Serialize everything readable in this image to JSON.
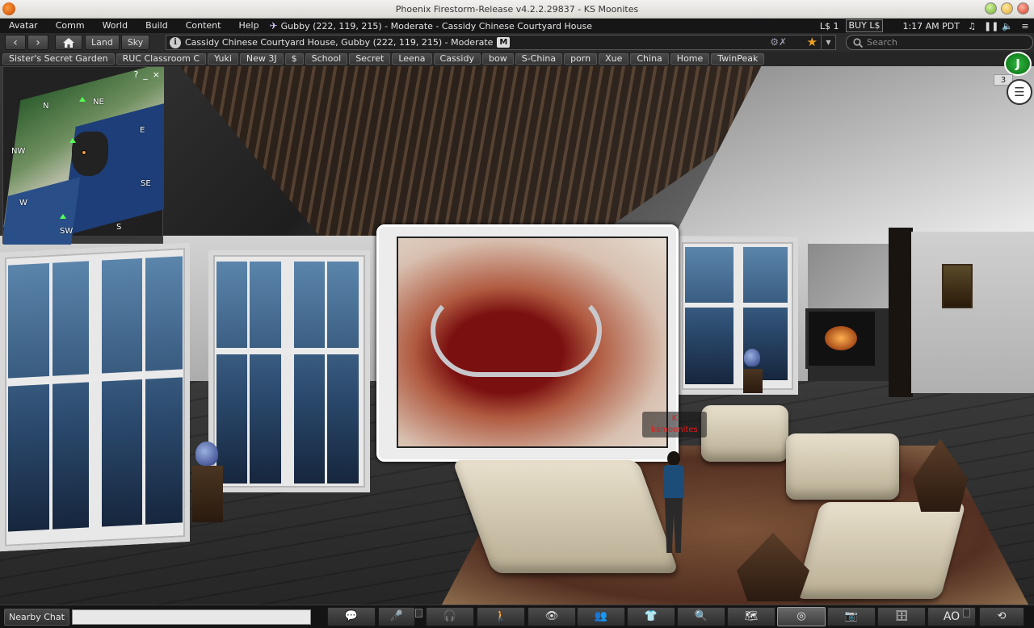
{
  "window": {
    "title": "Phoenix Firestorm-Release v4.2.2.29837 - KS Moonites"
  },
  "menubar": {
    "items": [
      "Avatar",
      "Comm",
      "World",
      "Build",
      "Content",
      "Help"
    ],
    "location": "Gubby (222, 119, 215) - Moderate - Cassidy Chinese Courtyard House",
    "balance": "L$ 1",
    "buy_label": "BUY L$",
    "time": "1:17 AM PDT"
  },
  "navbar": {
    "land_label": "Land",
    "sky_label": "Sky",
    "address": "Cassidy Chinese Courtyard House, Gubby (222, 119, 215) - Moderate",
    "maturity_badge": "M",
    "search_placeholder": "Search"
  },
  "favorites": [
    "Sister's Secret Garden",
    "RUC Classroom C",
    "Yuki",
    "New 3J",
    "$",
    "School",
    "Secret",
    "Leena",
    "Cassidy",
    "bow",
    "S-China",
    "porn",
    "Xue",
    "China",
    "Home",
    "TwinPeak"
  ],
  "minimap": {
    "help": "?",
    "minimize": "_",
    "close": "×",
    "directions": {
      "n": "N",
      "ne": "NE",
      "e": "E",
      "se": "SE",
      "s": "S",
      "sw": "SW",
      "w": "W",
      "nw": "NW"
    }
  },
  "overlay": {
    "radar_label": "J",
    "notification_count": "3"
  },
  "avatar": {
    "name_line1": "K",
    "name_line2": "ksmoonites"
  },
  "bottombar": {
    "chat_label": "Nearby Chat",
    "ao_label": "AO"
  }
}
